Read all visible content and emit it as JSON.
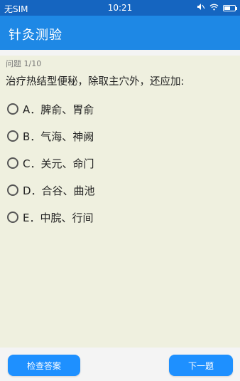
{
  "status_bar": {
    "carrier": "无SIM",
    "time": "10:21",
    "icons": [
      "mute-icon",
      "wifi-icon",
      "battery-icon"
    ],
    "battery_level": 0.6
  },
  "app_bar": {
    "title": "针灸测验"
  },
  "quiz": {
    "progress": "问题 1/10",
    "question": "治疗热结型便秘，除取主穴外，还应加:",
    "options": [
      {
        "letter": "A",
        "text": "A．脾俞、胃俞"
      },
      {
        "letter": "B",
        "text": "B．气海、神阙"
      },
      {
        "letter": "C",
        "text": "C．关元、命门"
      },
      {
        "letter": "D",
        "text": "D．合谷、曲池"
      },
      {
        "letter": "E",
        "text": "E．中脘、行间"
      }
    ]
  },
  "buttons": {
    "check": "检查答案",
    "next": "下一题"
  },
  "colors": {
    "status_bar": "#1565c0",
    "app_bar": "#1e88e5",
    "question_panel": "#eff0df",
    "button": "#1e90ff"
  }
}
